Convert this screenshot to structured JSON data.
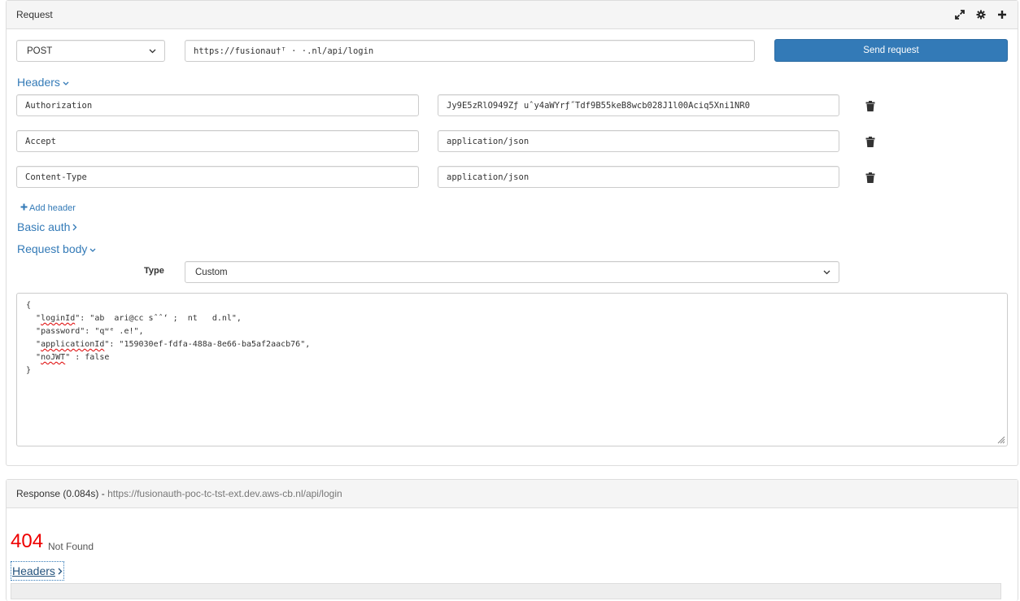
{
  "request": {
    "panel_title": "Request",
    "method": "POST",
    "url": "https://fusionau†ᵀ                              ·       ·.nl/api/login",
    "send_label": "Send request",
    "headers_toggle": "Headers",
    "headers": [
      {
        "name": "Authorization",
        "value": "Jy9E5zRlO949Zƒ        uˆy4aWYrƒ˝Tdf9B55keB8wcb028J1l00Aciq5Xni1NR0"
      },
      {
        "name": "Accept",
        "value": "application/json"
      },
      {
        "name": "Content-Type",
        "value": "application/json"
      }
    ],
    "add_header_label": "Add header",
    "basic_auth_label": "Basic auth",
    "request_body_label": "Request body",
    "type_label": "Type",
    "type_value": "Custom",
    "body": {
      "open": "{",
      "lines": [
        {
          "pad": "  ",
          "key": "loginId",
          "rest": ": \"ab  ari@cc sˆˆ‘ ;  nt   d.nl\","
        },
        {
          "pad": "  ",
          "key": "password",
          "rest": ": \"qʷᵉ .e!\","
        },
        {
          "pad": "  ",
          "key": "applicationId",
          "rest": ": \"159030ef-fdfa-488a-8e66-ba5af2aacb76\","
        },
        {
          "pad": "  ",
          "key": "noJWT",
          "rest": " : false"
        }
      ],
      "close": "}"
    }
  },
  "response": {
    "title": "Response (0.084s) -",
    "url": "https://fusionauth-poc-tc-tst-ext.dev.aws-cb.nl/api/login",
    "status_code": "404",
    "status_text": "Not Found",
    "headers_toggle": "Headers"
  },
  "icons": {
    "expand": "expand-icon",
    "settings": "gear-icon",
    "add": "plus-icon",
    "delete": "trash-icon"
  },
  "colors": {
    "primary": "#337ab7",
    "error": "#e00000"
  }
}
